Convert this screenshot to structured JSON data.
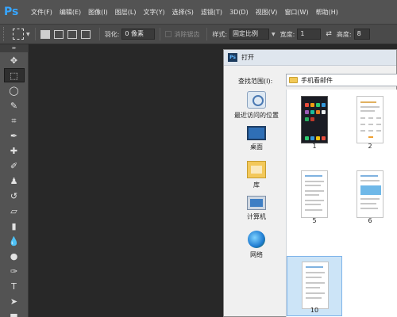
{
  "app": {
    "logo_text": "Ps"
  },
  "menu": {
    "items": [
      "文件(F)",
      "编辑(E)",
      "图像(I)",
      "图层(L)",
      "文字(Y)",
      "选择(S)",
      "滤镜(T)",
      "3D(D)",
      "视图(V)",
      "窗口(W)",
      "帮助(H)"
    ]
  },
  "options": {
    "feather_label": "羽化:",
    "feather_value": "0 像素",
    "antialias_label": "消除锯齿",
    "style_label": "样式:",
    "style_value": "固定比例",
    "width_label": "宽度:",
    "width_value": "1",
    "height_label": "高度:",
    "height_value": "8"
  },
  "toolbox": {
    "grip": "▸▸",
    "tools": [
      {
        "name": "move-tool-icon",
        "glyph": "✥"
      },
      {
        "name": "marquee-tool-icon",
        "glyph": "⬚"
      },
      {
        "name": "lasso-tool-icon",
        "glyph": "◯"
      },
      {
        "name": "quick-select-tool-icon",
        "glyph": "✎"
      },
      {
        "name": "crop-tool-icon",
        "glyph": "⌗"
      },
      {
        "name": "eyedropper-tool-icon",
        "glyph": "✒"
      },
      {
        "name": "healing-brush-tool-icon",
        "glyph": "✚"
      },
      {
        "name": "brush-tool-icon",
        "glyph": "✐"
      },
      {
        "name": "clone-stamp-tool-icon",
        "glyph": "♟"
      },
      {
        "name": "history-brush-tool-icon",
        "glyph": "↺"
      },
      {
        "name": "eraser-tool-icon",
        "glyph": "▱"
      },
      {
        "name": "gradient-tool-icon",
        "glyph": "▮"
      },
      {
        "name": "blur-tool-icon",
        "glyph": "💧"
      },
      {
        "name": "dodge-tool-icon",
        "glyph": "●"
      },
      {
        "name": "pen-tool-icon",
        "glyph": "✑"
      },
      {
        "name": "type-tool-icon",
        "glyph": "T"
      },
      {
        "name": "path-selection-tool-icon",
        "glyph": "➤"
      },
      {
        "name": "shape-tool-icon",
        "glyph": "■"
      }
    ]
  },
  "dialog": {
    "title": "打开",
    "look_in_label": "查找范围(I):",
    "look_in_value": "手机看邮件",
    "places": [
      {
        "label": "最近访问的位置",
        "icon": "recent-places-icon"
      },
      {
        "label": "桌面",
        "icon": "desktop-icon"
      },
      {
        "label": "库",
        "icon": "library-icon"
      },
      {
        "label": "计算机",
        "icon": "computer-icon"
      },
      {
        "label": "网络",
        "icon": "network-icon"
      }
    ],
    "files": [
      {
        "label": "1"
      },
      {
        "label": "2"
      },
      {
        "label": "5"
      },
      {
        "label": "6"
      },
      {
        "label": "10",
        "selected": true
      }
    ],
    "selection_color": "#cce4f7"
  },
  "colors": {
    "menubar": "#535353",
    "canvas": "#282828",
    "ps_blue": "#37a6ff"
  }
}
